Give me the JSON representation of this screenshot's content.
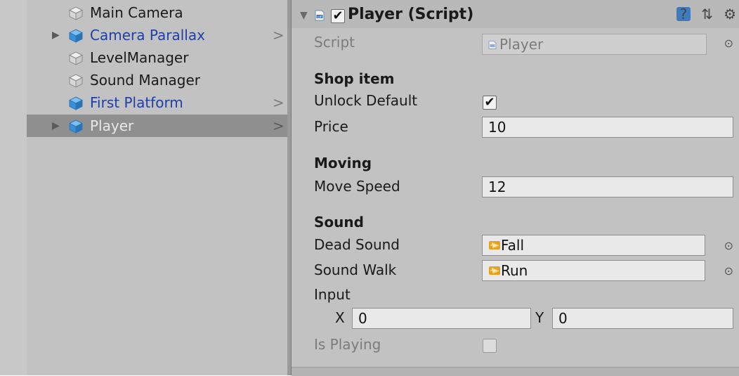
{
  "hierarchy": {
    "items": [
      {
        "label": "Main Camera",
        "prefab": false,
        "has_children": false,
        "selected": false
      },
      {
        "label": "Camera Parallax",
        "prefab": true,
        "has_children": true,
        "selected": false
      },
      {
        "label": "LevelManager",
        "prefab": false,
        "has_children": false,
        "selected": false
      },
      {
        "label": "Sound Manager",
        "prefab": false,
        "has_children": false,
        "selected": false
      },
      {
        "label": "First Platform",
        "prefab": true,
        "has_children": false,
        "selected": false
      },
      {
        "label": "Player",
        "prefab": true,
        "has_children": true,
        "selected": true
      }
    ],
    "foldout_glyph": "▶",
    "arrow_glyph": ">"
  },
  "inspector": {
    "component": {
      "title": "Player (Script)",
      "enabled": true,
      "icons": [
        "help-icon",
        "preset-icon",
        "gear-icon"
      ]
    },
    "script_field": {
      "label": "Script",
      "value": "Player"
    },
    "sections": {
      "shop": "Shop item",
      "moving": "Moving",
      "sound": "Sound"
    },
    "fields": {
      "unlock_default": {
        "label": "Unlock Default",
        "checked": true
      },
      "price": {
        "label": "Price",
        "value": "10"
      },
      "move_speed": {
        "label": "Move Speed",
        "value": "12"
      },
      "dead_sound": {
        "label": "Dead Sound",
        "value": "Fall"
      },
      "sound_walk": {
        "label": "Sound Walk",
        "value": "Run"
      },
      "input": {
        "label": "Input",
        "x_label": "X",
        "x_value": "0",
        "y_label": "Y",
        "y_value": "0"
      },
      "is_playing": {
        "label": "Is Playing",
        "checked": false
      }
    },
    "glyphs": {
      "checkmark": "✔",
      "object_picker": "⊙",
      "fold_open": "▼"
    }
  },
  "colors": {
    "prefab_text": "#1f3fa8",
    "selected_row": "#8f8f8f",
    "panel_bg": "#c2c2c2",
    "cube_blue": "#3b8fd6",
    "audio_orange": "#e8a020"
  }
}
